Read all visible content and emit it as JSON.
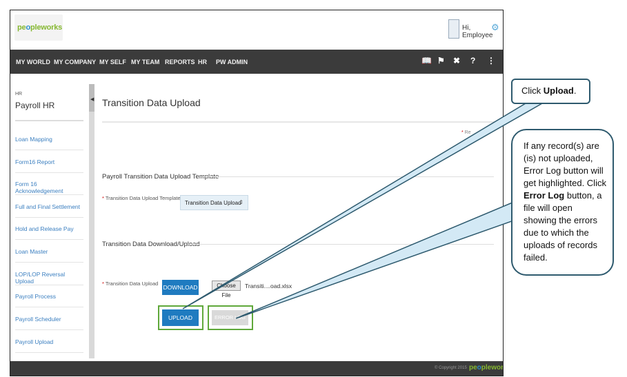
{
  "header": {
    "logo_text": "peopleworks",
    "greeting": "Hi, Employee"
  },
  "nav": {
    "items": [
      "MY WORLD",
      "MY COMPANY",
      "MY SELF",
      "MY TEAM",
      "REPORTS",
      "HR",
      "PW ADMIN"
    ],
    "icons": [
      "book-icon",
      "flag-icon",
      "tools-icon",
      "help-icon",
      "share-icon"
    ]
  },
  "sidebar": {
    "module": "HR",
    "title": "Payroll HR",
    "items": [
      "Loan Mapping",
      "Form16 Report",
      "Form 16 Acknowledgement",
      "Full and Final Settlement",
      "Hold and Release Pay",
      "Loan Master",
      "LOP/LOP Reversal Upload",
      "Payroll Process",
      "Payroll Scheduler",
      "Payroll Upload"
    ]
  },
  "main": {
    "title": "Transition Data Upload",
    "required_note": "Re",
    "section1": "Payroll Transition Data Upload Template",
    "template_label": "Transition Data Upload Template",
    "template_value": "Transition Data Upload",
    "section2": "Transition Data Download/Upload",
    "upload_label": "Transition Data Upload",
    "download_button": "DOWNLOAD",
    "choose_file_button": "Choose File",
    "file_name": "Transiti....oad.xlsx",
    "upload_button": "UPLOAD",
    "error_log_button": "ERROR LOG"
  },
  "footer": {
    "copyright": "© Copyright 2015",
    "logo_text": "peopleworks"
  },
  "callouts": {
    "upload": {
      "pre": "Click ",
      "bold": "Upload",
      "post": "."
    },
    "error": {
      "text1": "If any record(s) are (is) not uploaded, Error Log button will get highlighted. Click ",
      "bold": "Error Log",
      "text2": " button, a file will open showing the errors due to which the uploads of records failed."
    }
  },
  "colors": {
    "nav_bg": "#3b3b3b",
    "button_blue": "#1f7bc0",
    "highlight_green": "#5fa83a",
    "callout_border": "#2e5a6e",
    "link_blue": "#3b7fc0"
  }
}
